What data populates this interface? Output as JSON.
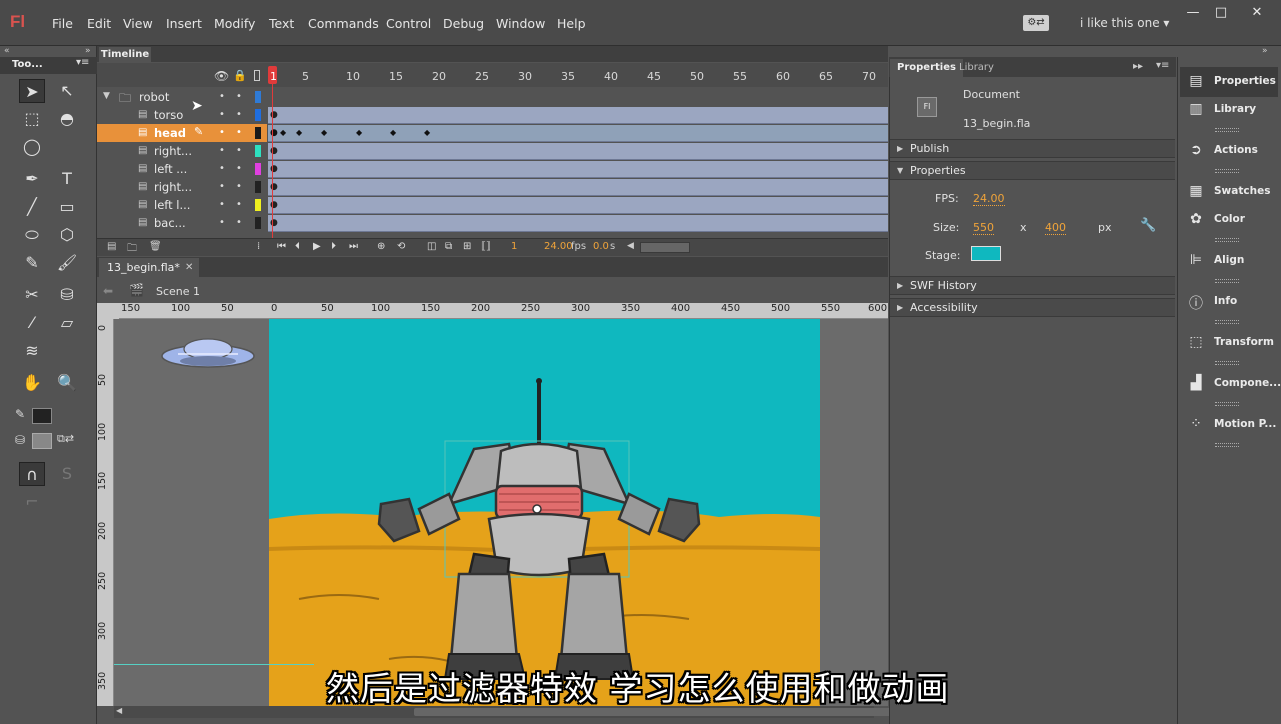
{
  "app": {
    "logo": "Fl",
    "workspace": "i like this one",
    "window_controls": [
      "—",
      "□",
      "✕"
    ]
  },
  "menu": [
    "File",
    "Edit",
    "View",
    "Insert",
    "Modify",
    "Text",
    "Commands",
    "Control",
    "Debug",
    "Window",
    "Help"
  ],
  "tools_panel": {
    "title": "Too..."
  },
  "timeline": {
    "tab": "Timeline",
    "frame_numbers": [
      "1",
      "5",
      "10",
      "15",
      "20",
      "25",
      "30",
      "35",
      "40",
      "45",
      "50",
      "55",
      "60",
      "65",
      "70"
    ],
    "layers": [
      {
        "name": "robot",
        "type": "folder",
        "color": "#2f7bd6"
      },
      {
        "name": "torso",
        "type": "layer",
        "color": "#1f6ee0"
      },
      {
        "name": "head",
        "type": "layer",
        "color": "#1a1a1a",
        "selected": true
      },
      {
        "name": "right...",
        "type": "layer",
        "color": "#2ee0c0"
      },
      {
        "name": "left ...",
        "type": "layer",
        "color": "#e040e0"
      },
      {
        "name": "right...",
        "type": "layer",
        "color": "#222222"
      },
      {
        "name": "left l...",
        "type": "layer",
        "color": "#f0f020"
      },
      {
        "name": "bac...",
        "type": "layer",
        "color": "#222222"
      }
    ],
    "current_frame": "1",
    "fps": "24.00",
    "fps_unit": "fps",
    "elapsed": "0.0",
    "elapsed_unit": "s"
  },
  "document": {
    "tab": "13_begin.fla*",
    "scene": "Scene 1"
  },
  "rulers": {
    "h": [
      "150",
      "100",
      "50",
      "0",
      "50",
      "100",
      "150",
      "200",
      "250",
      "300",
      "350",
      "400",
      "450",
      "500",
      "550",
      "600"
    ],
    "v": [
      "0",
      "50",
      "100",
      "150",
      "200",
      "250",
      "300",
      "350"
    ]
  },
  "properties": {
    "tabs": [
      "Properties",
      "Library"
    ],
    "doc_type": "Document",
    "doc_icon": "Fl",
    "doc_name": "13_begin.fla",
    "sections": {
      "publish": "Publish",
      "properties": "Properties",
      "swf_history": "SWF History",
      "accessibility": "Accessibility"
    },
    "fps_label": "FPS:",
    "fps_value": "24.00",
    "size_label": "Size:",
    "width": "550",
    "size_x": "x",
    "height": "400",
    "size_unit": "px",
    "stage_label": "Stage:",
    "stage_color": "#0fb8bf"
  },
  "dock": [
    "Properties",
    "Library",
    "Actions",
    "Swatches",
    "Color",
    "Align",
    "Info",
    "Transform",
    "Compone...",
    "Motion P..."
  ],
  "subtitle": "然后是过滤器特效 学习怎么使用和做动画"
}
